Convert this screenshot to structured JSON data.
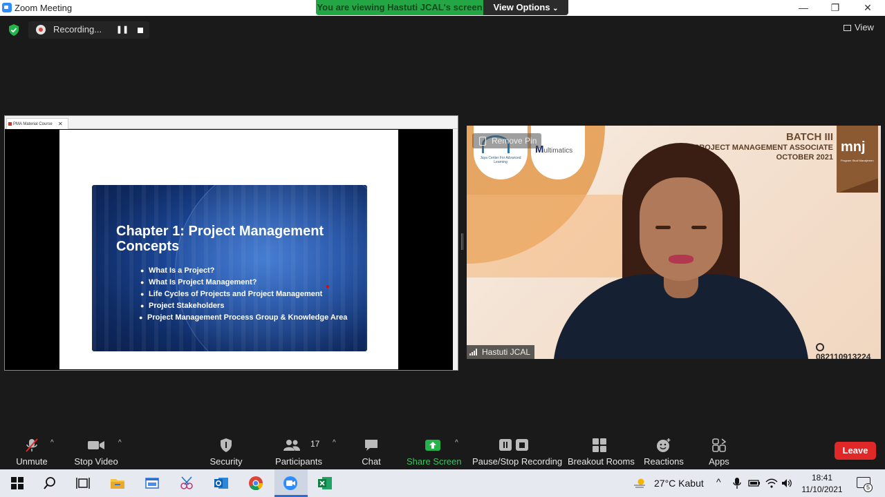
{
  "window": {
    "title": "Zoom Meeting"
  },
  "banner": {
    "viewing_prefix": "You are viewing ",
    "viewing_name": "Hastuti JCAL's screen",
    "view_options": "View Options"
  },
  "recording": {
    "status": "Recording..."
  },
  "view": {
    "label": "View"
  },
  "shared_screen": {
    "tab_title": "PMA Material Course",
    "slide": {
      "title": "Chapter 1: Project Management Concepts",
      "bullets": [
        "What Is a Project?",
        "What Is Project Management?",
        "Life Cycles of Projects and Project Management",
        "Project Stakeholders",
        "Project Management Process Group & Knowledge Area"
      ]
    }
  },
  "video": {
    "remove_pin": "Remove Pin",
    "participant_name": "Hastuti JCAL",
    "jcal_logo_text": "Jaya Center For Advanced Learning",
    "multimatics_logo_text": "ultimatics",
    "batch_title": "BATCH III",
    "batch_program": "PROJECT MANAGEMENT ASSOCIATE",
    "batch_date": "OCTOBER 2021",
    "badge_logo": "mnj",
    "badge_caption": "Program Studi Manajemen",
    "phone": "082110913224"
  },
  "toolbar": {
    "unmute": "Unmute",
    "stop_video": "Stop Video",
    "security": "Security",
    "participants": "Participants",
    "participants_count": "17",
    "chat": "Chat",
    "share_screen": "Share Screen",
    "pause_stop_recording": "Pause/Stop Recording",
    "breakout_rooms": "Breakout Rooms",
    "reactions": "Reactions",
    "apps": "Apps",
    "leave": "Leave"
  },
  "taskbar": {
    "weather": "27°C  Kabut",
    "time": "18:41",
    "date": "11/10/2021",
    "notification_count": "5"
  },
  "colors": {
    "share_green": "#23a745",
    "leave_red": "#e02828",
    "toolbar_bg": "#1a1a1a"
  }
}
